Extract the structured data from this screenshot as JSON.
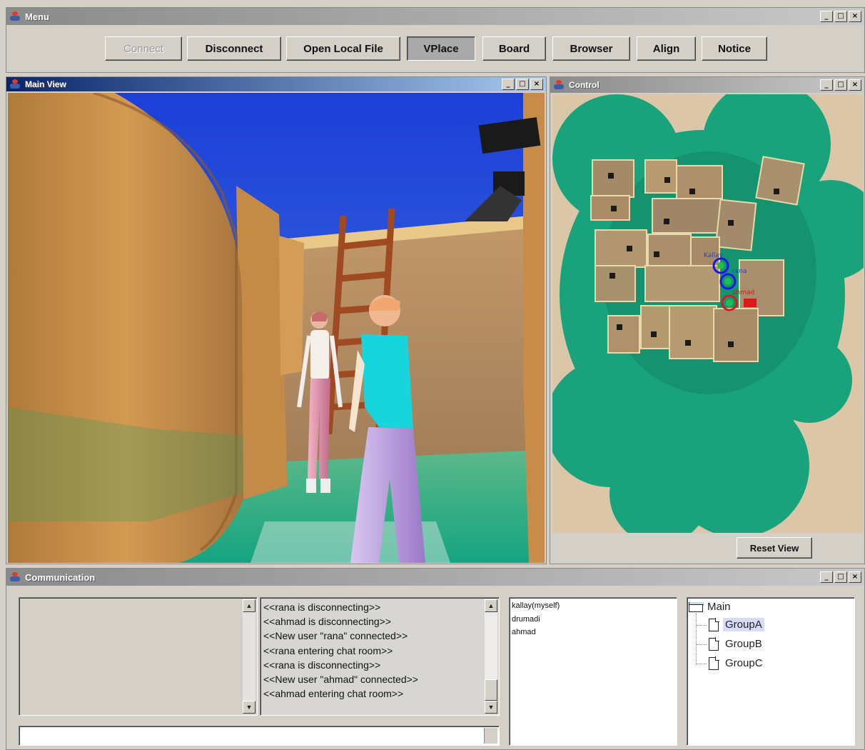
{
  "menu": {
    "title": "Menu",
    "buttons": {
      "connect": "Connect",
      "disconnect": "Disconnect",
      "open_local_file": "Open Local File",
      "vplace": "VPlace",
      "board": "Board",
      "browser": "Browser",
      "align": "Align",
      "notice": "Notice"
    },
    "disabled": [
      "Connect"
    ],
    "pressed": "VPlace"
  },
  "window_controls": {
    "minimize": "_",
    "maximize": "□",
    "close": "×"
  },
  "main_view": {
    "title": "Main View"
  },
  "control": {
    "title": "Control",
    "reset_label": "Reset View",
    "avatar_labels": [
      "Kallay",
      "rana",
      "ahmad"
    ]
  },
  "communication": {
    "title": "Communication",
    "chat_lines": [
      "<<rana is disconnecting>>",
      "<<ahmad is disconnecting>>",
      "<<New user \"rana\" connected>>",
      "<<rana entering chat room>>",
      "<<rana is disconnecting>>",
      "<<New user \"ahmad\" connected>>",
      "<<ahmad entering chat room>>"
    ],
    "users": [
      "kallay(myself)",
      "drumadi",
      "ahmad"
    ],
    "tree": {
      "root": "Main",
      "groups": [
        "GroupA",
        "GroupB",
        "GroupC"
      ],
      "selected": "GroupA"
    },
    "message_input": "",
    "message_draft": "",
    "scroll_arrows": {
      "up": "▲",
      "down": "▼"
    }
  },
  "colors": {
    "title_active": "#0a246a",
    "title_inactive": "#8a8a8a",
    "panel": "#d4d0c8",
    "sky": "#2a4ad8",
    "grass": "#1fa07a"
  }
}
